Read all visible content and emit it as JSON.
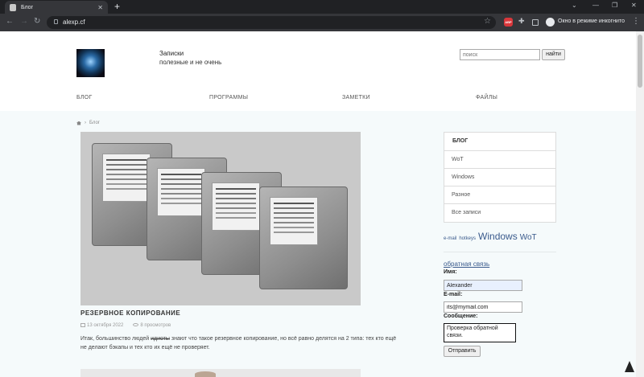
{
  "browser": {
    "tab_title": "Блог",
    "tab_close": "✕",
    "new_tab": "+",
    "url": "alexp.cf",
    "incognito_label": "Окно в режиме инкогнито",
    "abp_badge": "ABP"
  },
  "header": {
    "title": "Записки",
    "subtitle": "полезные и не очень",
    "search_placeholder": "поиск",
    "search_button": "найти"
  },
  "nav": [
    "БЛОГ",
    "ПРОГРАММЫ",
    "ЗАМЕТКИ",
    "ФАЙЛЫ"
  ],
  "breadcrumb": {
    "separator": "›",
    "current": "Блог"
  },
  "post": {
    "title": "РЕЗЕРВНОЕ КОПИРОВАНИЕ",
    "date": "13 октября 2022",
    "views": "8 просмотров",
    "text_before": "Итак, большинство людей ",
    "text_struck": "идиоты",
    "text_after": " знают что такое резервное копирование, но всё равно делятся на 2 типа: тех кто ещё не делают бэкапы и тех кто их ещё не проверяет."
  },
  "sidebar": {
    "header": "БЛОГ",
    "items": [
      "WoT",
      "Windows",
      "Разное",
      "Все записи"
    ]
  },
  "tags": [
    {
      "label": "e-mail",
      "size": "s"
    },
    {
      "label": "hotkeys",
      "size": "s"
    },
    {
      "label": "Windows",
      "size": "l"
    },
    {
      "label": "WoT",
      "size": "m"
    }
  ],
  "feedback": {
    "link": "обратная связь",
    "name_label": "Имя:",
    "name_value": "Alexander",
    "email_label": "E-mail:",
    "email_value": "its@mymail.com",
    "message_label": "Сообщение:",
    "message_value": "Проверка обратной связи.",
    "submit": "Отправить"
  },
  "icons": [
    "back-icon",
    "forward-icon",
    "reload-icon",
    "lock-icon",
    "star-icon",
    "puzzle-icon",
    "sidepanel-icon",
    "incognito-icon",
    "menu-icon",
    "home-icon",
    "calendar-icon",
    "eye-icon"
  ]
}
